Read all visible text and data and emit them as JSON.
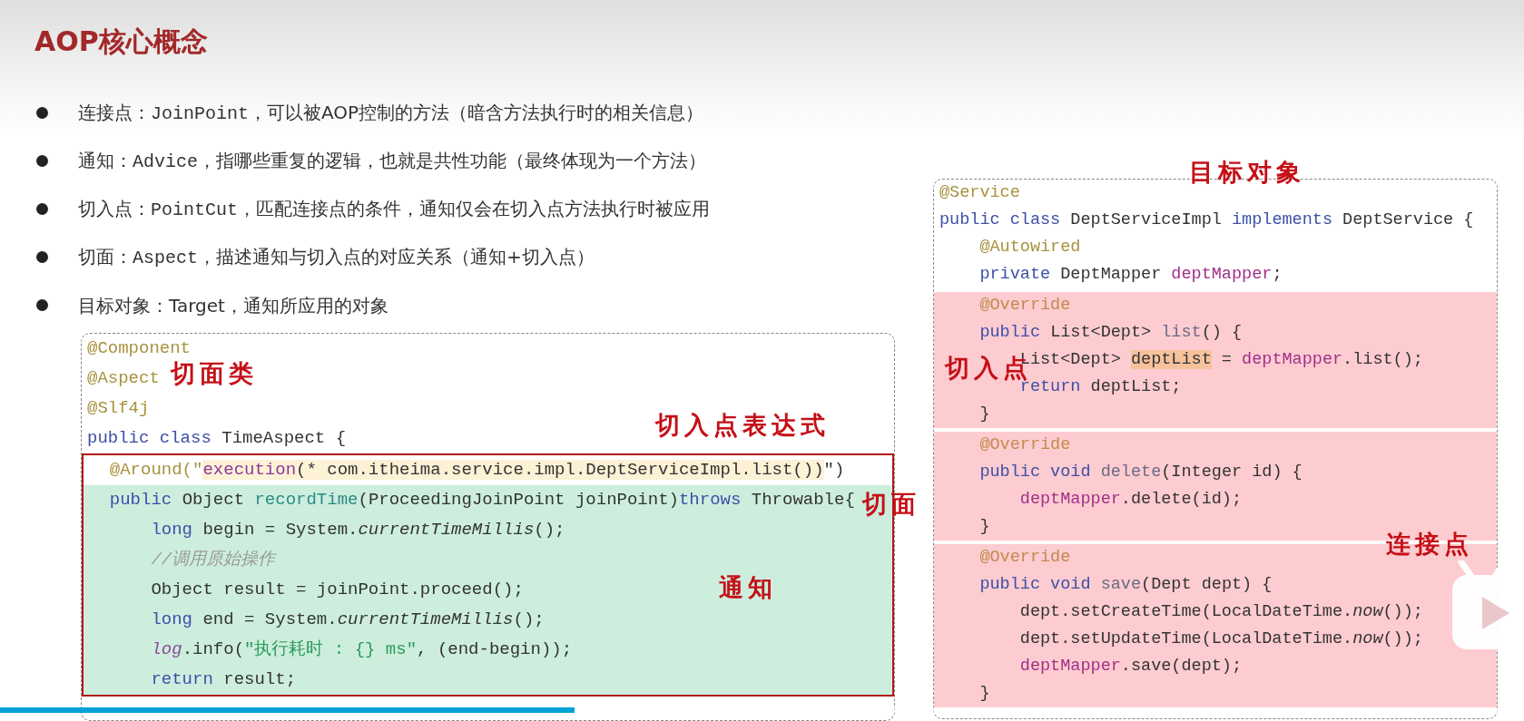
{
  "slide": {
    "title": "AOP核心概念",
    "bullets": [
      {
        "parts": [
          {
            "text": "连接点：",
            "mono": false
          },
          {
            "text": "JoinPoint",
            "mono": true
          },
          {
            "text": "，可以被AOP控制的方法（暗含方法执行时的相关信息）",
            "mono": false
          }
        ]
      },
      {
        "parts": [
          {
            "text": "通知：",
            "mono": false
          },
          {
            "text": "Advice",
            "mono": true
          },
          {
            "text": "，指哪些重复的逻辑，也就是共性功能（最终体现为一个方法）",
            "mono": false
          }
        ]
      },
      {
        "parts": [
          {
            "text": "切入点：",
            "mono": false
          },
          {
            "text": "PointCut",
            "mono": true
          },
          {
            "text": "，匹配连接点的条件，通知仅会在切入点方法执行时被应用",
            "mono": false
          }
        ]
      },
      {
        "parts": [
          {
            "text": "切面：",
            "mono": false
          },
          {
            "text": "Aspect",
            "mono": true
          },
          {
            "text": "，描述通知与切入点的对应关系（通知+切入点）",
            "mono": false
          }
        ]
      },
      {
        "parts": [
          {
            "text": "目标对象：Target，通知所应用的对象",
            "mono": false
          }
        ]
      }
    ],
    "aspect_code": {
      "blocks": [
        {
          "kind": "plain",
          "lines": [
            [
              {
                "text": "@Component",
                "kind": "ann"
              }
            ],
            [
              {
                "text": "@Aspect",
                "kind": "ann"
              }
            ],
            [
              {
                "text": "@Slf4j",
                "kind": "ann"
              }
            ],
            [
              {
                "text": "public class ",
                "kind": "kw"
              },
              {
                "text": "TimeAspect {",
                "kind": "plain"
              }
            ]
          ]
        },
        {
          "kind": "aspect",
          "lines": [
            [
              {
                "text": "  @Around(\"",
                "kind": "ann"
              },
              {
                "text": "execution",
                "kind": "hl-fn"
              },
              {
                "text": "(* com.itheima.service.impl.DeptServiceImpl.list())",
                "kind": "hl"
              },
              {
                "text": "\")",
                "kind": "plain"
              }
            ]
          ]
        },
        {
          "kind": "advice",
          "lines": [
            [
              {
                "text": "  public ",
                "kind": "kw"
              },
              {
                "text": "Object ",
                "kind": "plain"
              },
              {
                "text": "recordTime",
                "kind": "fn"
              },
              {
                "text": "(ProceedingJoinPoint joinPoint)",
                "kind": "plain"
              },
              {
                "text": "throws ",
                "kind": "kw"
              },
              {
                "text": "Throwable{",
                "kind": "plain"
              }
            ],
            [
              {
                "text": "      long ",
                "kind": "kw"
              },
              {
                "text": "begin = System.",
                "kind": "plain"
              },
              {
                "text": "currentTimeMillis",
                "kind": "static"
              },
              {
                "text": "();",
                "kind": "plain"
              }
            ],
            [
              {
                "text": "      //调用原始操作",
                "kind": "cmt"
              }
            ],
            [
              {
                "text": "      Object result = joinPoint.proceed();",
                "kind": "plain"
              }
            ],
            [
              {
                "text": "      long ",
                "kind": "kw"
              },
              {
                "text": "end = System.",
                "kind": "plain"
              },
              {
                "text": "currentTimeMillis",
                "kind": "static"
              },
              {
                "text": "();",
                "kind": "plain"
              }
            ],
            [
              {
                "text": "      log",
                "kind": "logvar"
              },
              {
                "text": ".info(",
                "kind": "plain"
              },
              {
                "text": "\"执行耗时 : {} ms\"",
                "kind": "str"
              },
              {
                "text": ", (end-begin));",
                "kind": "plain"
              }
            ],
            [
              {
                "text": "      return ",
                "kind": "kw"
              },
              {
                "text": "result;",
                "kind": "plain"
              }
            ]
          ]
        }
      ]
    },
    "target_code": {
      "blocks": [
        {
          "kind": "plain",
          "lines": [
            [
              {
                "text": "@Service",
                "kind": "ann"
              }
            ],
            [
              {
                "text": "public class ",
                "kind": "kw"
              },
              {
                "text": "DeptServiceImpl ",
                "kind": "plain"
              },
              {
                "text": "implements ",
                "kind": "kw"
              },
              {
                "text": "DeptService {",
                "kind": "plain"
              }
            ],
            [
              {
                "text": "    @Autowired",
                "kind": "ann"
              }
            ],
            [
              {
                "text": "    private ",
                "kind": "kw"
              },
              {
                "text": "DeptMapper ",
                "kind": "plain"
              },
              {
                "text": "deptMapper",
                "kind": "field"
              },
              {
                "text": ";",
                "kind": "plain"
              }
            ]
          ]
        },
        {
          "kind": "joinpoint",
          "lines": [
            [
              {
                "text": "    @Override",
                "kind": "ann-alt"
              }
            ],
            [
              {
                "text": "    public ",
                "kind": "kw"
              },
              {
                "text": "List<Dept> ",
                "kind": "plain"
              },
              {
                "text": "list",
                "kind": "method"
              },
              {
                "text": "() {",
                "kind": "plain"
              }
            ],
            [
              {
                "text": "        List<Dept> ",
                "kind": "plain"
              },
              {
                "text": "deptList",
                "kind": "mark"
              },
              {
                "text": " = ",
                "kind": "plain"
              },
              {
                "text": "deptMapper",
                "kind": "field"
              },
              {
                "text": ".list();",
                "kind": "plain"
              }
            ],
            [
              {
                "text": "        return ",
                "kind": "kw"
              },
              {
                "text": "deptList;",
                "kind": "plain"
              }
            ],
            [
              {
                "text": "    }",
                "kind": "plain"
              }
            ]
          ]
        },
        {
          "kind": "joinpoint",
          "lines": [
            [
              {
                "text": "    @Override",
                "kind": "ann-alt"
              }
            ],
            [
              {
                "text": "    public void ",
                "kind": "kw"
              },
              {
                "text": "delete",
                "kind": "method"
              },
              {
                "text": "(Integer id) {",
                "kind": "plain"
              }
            ],
            [
              {
                "text": "        deptMapper",
                "kind": "field"
              },
              {
                "text": ".delete(id);",
                "kind": "plain"
              }
            ],
            [
              {
                "text": "    }",
                "kind": "plain"
              }
            ]
          ]
        },
        {
          "kind": "joinpoint",
          "lines": [
            [
              {
                "text": "    @Override",
                "kind": "ann-alt"
              }
            ],
            [
              {
                "text": "    public void ",
                "kind": "kw"
              },
              {
                "text": "save",
                "kind": "method"
              },
              {
                "text": "(Dept dept) {",
                "kind": "plain"
              }
            ],
            [
              {
                "text": "        dept.setCreateTime(LocalDateTime.",
                "kind": "plain"
              },
              {
                "text": "now",
                "kind": "static"
              },
              {
                "text": "());",
                "kind": "plain"
              }
            ],
            [
              {
                "text": "        dept.setUpdateTime(LocalDateTime.",
                "kind": "plain"
              },
              {
                "text": "now",
                "kind": "static"
              },
              {
                "text": "());",
                "kind": "plain"
              }
            ],
            [
              {
                "text": "        deptMapper",
                "kind": "field"
              },
              {
                "text": ".save(dept);",
                "kind": "plain"
              }
            ],
            [
              {
                "text": "    }",
                "kind": "plain"
              }
            ]
          ]
        }
      ]
    },
    "handwritten_notes": [
      {
        "text": "切面类"
      },
      {
        "text": "切入点表达式"
      },
      {
        "text": "切面"
      },
      {
        "text": "通知"
      },
      {
        "text": "目标对象"
      },
      {
        "text": "切入点"
      },
      {
        "text": "连接点"
      }
    ]
  },
  "player": {
    "progress": {
      "level": 0.377
    }
  }
}
